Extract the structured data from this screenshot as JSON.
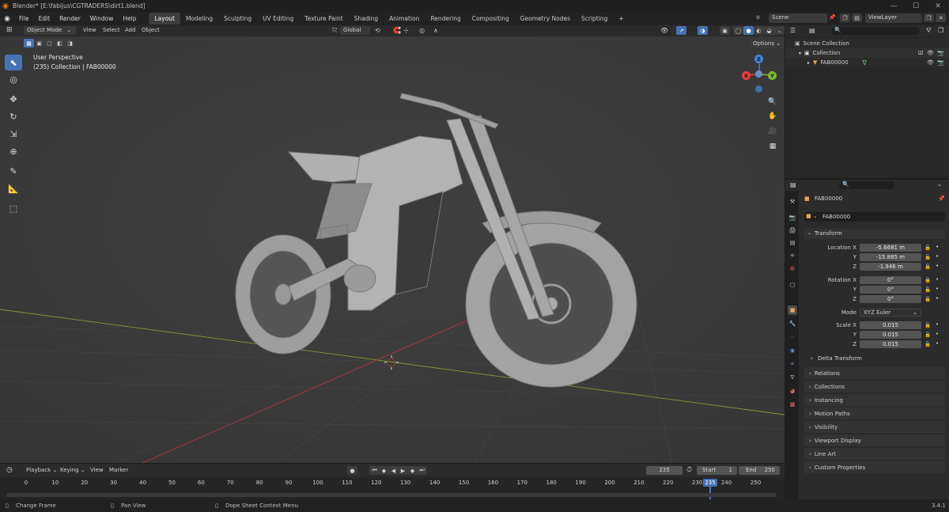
{
  "window": {
    "title": "Blender* [E:\\fabijus\\CGTRADERS\\dirt1.blend]"
  },
  "menu": [
    "File",
    "Edit",
    "Render",
    "Window",
    "Help"
  ],
  "workspaces": [
    "Layout",
    "Modeling",
    "Sculpting",
    "UV Editing",
    "Texture Paint",
    "Shading",
    "Animation",
    "Rendering",
    "Compositing",
    "Geometry Nodes",
    "Scripting"
  ],
  "workspace_add": "+",
  "scene": {
    "name": "Scene",
    "view_layer": "ViewLayer"
  },
  "viewport_header": {
    "mode": "Object Mode",
    "menus": [
      "View",
      "Select",
      "Add",
      "Object"
    ],
    "orientation": "Global",
    "options": "Options"
  },
  "viewport_overlay": {
    "view_name": "User Perspective",
    "collection_info": "(235) Collection | FAB00000"
  },
  "gizmo": {
    "z": "Z",
    "y": "Y",
    "x": "X"
  },
  "outliner": {
    "rows": [
      {
        "label": "Scene Collection"
      },
      {
        "label": "Collection"
      },
      {
        "label": "FAB00000"
      }
    ]
  },
  "properties": {
    "object_name": "FAB00000",
    "object_field": "FAB00000",
    "transform_title": "Transform",
    "location": {
      "label_x": "Location X",
      "label_y": "Y",
      "label_z": "Z",
      "x": "-5.6681 m",
      "y": "-15.885 m",
      "z": "-1.946 m"
    },
    "rotation": {
      "label_x": "Rotation X",
      "label_y": "Y",
      "label_z": "Z",
      "x": "0°",
      "y": "0°",
      "z": "0°"
    },
    "mode": {
      "label": "Mode",
      "value": "XYZ Euler"
    },
    "scale": {
      "label_x": "Scale X",
      "label_y": "Y",
      "label_z": "Z",
      "x": "0.015",
      "y": "0.015",
      "z": "0.015"
    },
    "delta_transform": "Delta Transform",
    "panels": [
      "Relations",
      "Collections",
      "Instancing",
      "Motion Paths",
      "Visibility",
      "Viewport Display",
      "Line Art",
      "Custom Properties"
    ]
  },
  "timeline": {
    "menus": [
      "Playback",
      "Keying",
      "View",
      "Marker"
    ],
    "current_frame": "235",
    "start_label": "Start",
    "start": "1",
    "end_label": "End",
    "end": "250",
    "ticks": [
      "0",
      "10",
      "20",
      "30",
      "40",
      "50",
      "60",
      "70",
      "80",
      "90",
      "100",
      "110",
      "120",
      "130",
      "140",
      "150",
      "160",
      "170",
      "180",
      "190",
      "200",
      "210",
      "220",
      "230",
      "240",
      "250"
    ],
    "playhead_label": "235"
  },
  "status_bar": {
    "items": [
      "Change Frame",
      "Pan View",
      "Dope Sheet Context Menu"
    ],
    "version": "3.4.1"
  },
  "colors": {
    "accent": "#4772b3",
    "axis_x": "#e0413f",
    "axis_y": "#7cb82c",
    "axis_z": "#3f84d8",
    "viewport_bg": "#3c3c3c"
  }
}
